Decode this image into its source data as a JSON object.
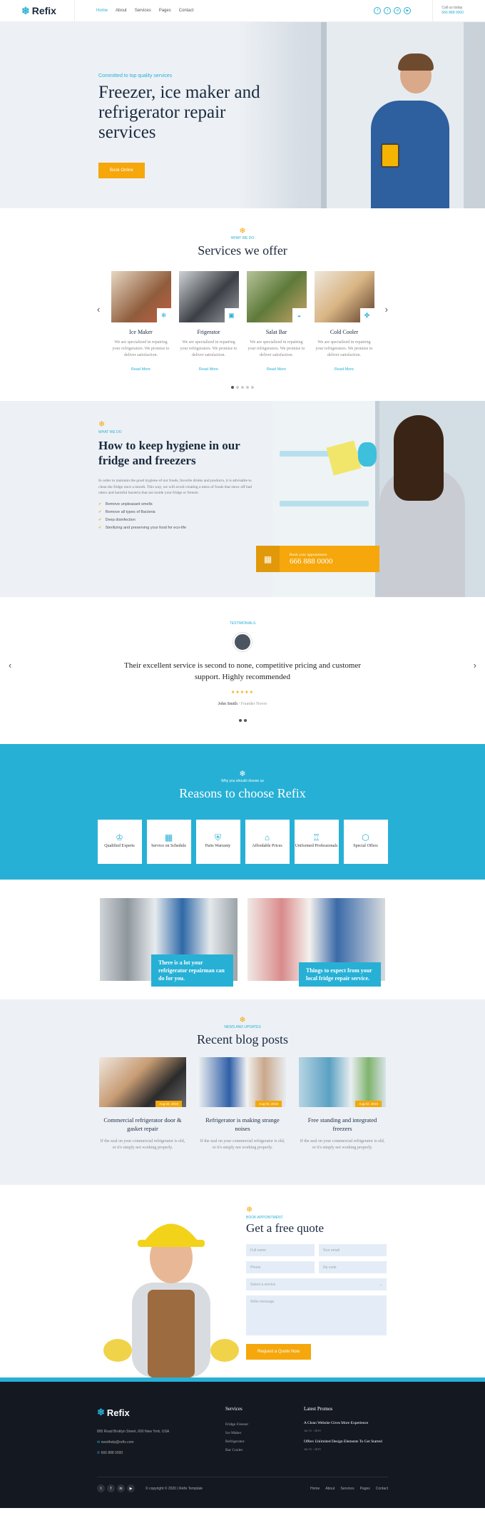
{
  "header": {
    "brand": "Refix",
    "nav": [
      "Home",
      "About",
      "Services",
      "Pages",
      "Contact"
    ],
    "social_icons": [
      "facebook-icon",
      "twitter-icon",
      "linkedin-icon",
      "youtube-icon"
    ],
    "call_label": "Call us today",
    "call_number": "666 888 0000"
  },
  "hero": {
    "kicker": "Committed to top quality services",
    "title": "Freezer, ice maker and refrigerator repair services",
    "button": "Book Online"
  },
  "services": {
    "kicker": "WHAT WE DO",
    "title": "Services we offer",
    "cards": [
      {
        "title": "Ice Maker",
        "desc": "We are specialized in repairing your refrigerators. We promise to deliver satisfaction.",
        "link": "Read More",
        "icon": "snowflake-icon"
      },
      {
        "title": "Frigerator",
        "desc": "We are specialized in repairing your refrigerators. We promise to deliver satisfaction.",
        "link": "Read More",
        "icon": "fridge-icon"
      },
      {
        "title": "Salat Bar",
        "desc": "We are specialized in repairing your refrigerators. We promise to deliver satisfaction.",
        "link": "Read More",
        "icon": "bowl-icon"
      },
      {
        "title": "Cold Cooler",
        "desc": "We are specialized in repairing your refrigerators. We promise to deliver satisfaction.",
        "link": "Read More",
        "icon": "fan-icon"
      }
    ]
  },
  "hygiene": {
    "kicker": "WHAT WE DO",
    "title": "How to keep hygiene in our fridge and freezers",
    "paragraph": "In order to maintain the good hygiene of our foods, favorite drinks and products, it is advisable to clean the fridge once a month. This way, we will avoid creating a mess of foods that show off bad odors and harmful bacteria that are inside your fridge or freezer.",
    "bullets": [
      "Remove unpleasant smells",
      "Remove all types of Bacteria",
      "Deep disinfection",
      "Sterilizing and preserving your food for eco-life"
    ],
    "book_label": "Book your appointment",
    "book_number": "666 888 0000"
  },
  "testimonial": {
    "kicker": "TESTIMONIALS",
    "quote": "Their excellent service is second to none, competitive pricing and customer support. Highly recommended",
    "stars": "★★★★★",
    "name": "John Smith",
    "role": " / Founder Novro"
  },
  "reasons": {
    "kicker": "Why you should choose us",
    "title": "Reasons to choose Refix",
    "items": [
      {
        "label": "Qualified Experts",
        "icon": "medal-icon"
      },
      {
        "label": "Service on Schedule",
        "icon": "calendar-icon"
      },
      {
        "label": "Parts Warranty",
        "icon": "shield-icon"
      },
      {
        "label": "Affordable Prices",
        "icon": "price-tag-icon"
      },
      {
        "label": "Uniformed Professionals",
        "icon": "shirt-icon"
      },
      {
        "label": "Special Offers",
        "icon": "box-icon"
      }
    ]
  },
  "promo": [
    {
      "text": "There is a lot your refrigerator repairman can do for you."
    },
    {
      "text": "Things to expect from your local fridge repair service."
    }
  ],
  "blog": {
    "kicker": "NEWS AND UPDATES",
    "title": "Recent blog posts",
    "posts": [
      {
        "date": "Aug 02, 2019",
        "title": "Commercial refrigerator door & gasket repair",
        "desc": "If the seal on your commercial refrigerator is old, or it's simply not working properly."
      },
      {
        "date": "Aug 02, 2019",
        "title": "Refrigerator is making strange noises",
        "desc": "If the seal on your commercial refrigerator is old, or it's simply not working properly."
      },
      {
        "date": "Aug 02, 2019",
        "title": "Free standing and integrated freezers",
        "desc": "If the seal on your commercial refrigerator is old, or it's simply not working properly."
      }
    ]
  },
  "quote": {
    "kicker": "BOOK APPOINTMENT",
    "title": "Get a free quote",
    "fields": {
      "name": "Full name",
      "email": "Your email",
      "phone": "Phone",
      "zip": "Zip code",
      "service": "Select a service",
      "message": "Write message"
    },
    "button": "Request a Quote Now"
  },
  "footer": {
    "brand": "Refix",
    "address": "800 Road Broklyn Street, 600 New York, USA",
    "email": "needhelp@refix.com",
    "phone": "666 888 0000",
    "services_title": "Services",
    "services": [
      "Fridge Freezer",
      "Ice Maker",
      "Refrigerator",
      "Bar Cooler"
    ],
    "promos_title": "Latest Promos",
    "promos": [
      {
        "title": "A Clean Website Gives More Experience",
        "date": "Jul 15 - 2019"
      },
      {
        "title": "Offers Unlimited Design Elements To Get Started",
        "date": "Jul 15 - 2019"
      }
    ],
    "copyright": "© copyright © 2020 | Refix Template",
    "links": [
      "Home",
      "About",
      "Services",
      "Pages",
      "Contact"
    ]
  },
  "colors": {
    "accent": "#27b0d5",
    "orange": "#f5a70b",
    "dark": "#131821",
    "light_bg": "#edf1f6"
  }
}
